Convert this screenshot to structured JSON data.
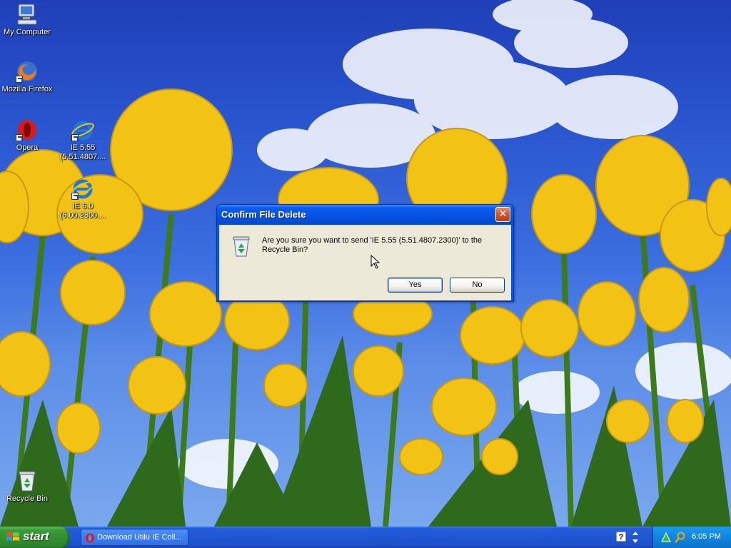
{
  "desktop": {
    "icons": [
      {
        "id": "my-computer",
        "label": "My Computer"
      },
      {
        "id": "firefox",
        "label": "Mozilla Firefox"
      },
      {
        "id": "opera",
        "label": "Opera"
      },
      {
        "id": "ie555",
        "label": "IE 5.55 (5.51.4807...."
      },
      {
        "id": "ie60",
        "label": "IE 6.0 (6.00.2800...."
      },
      {
        "id": "recycle-bin",
        "label": "Recycle Bin"
      }
    ]
  },
  "dialog": {
    "title": "Confirm File Delete",
    "close_glyph": "✕",
    "message": "Are you sure you want to send 'IE 5.55 (5.51.4807.2300)' to the Recycle Bin?",
    "yes_label": "Yes",
    "no_label": "No"
  },
  "taskbar": {
    "start_label": "start",
    "task_label": "Download Utilu IE Coll...",
    "clock": "6:05 PM"
  },
  "colors": {
    "titlebar": "#0a5cf2",
    "dialog_face": "#ece9d8",
    "start_green": "#3a9c3a",
    "taskbar_blue": "#2056d4",
    "tray_blue": "#0f86e0",
    "close_red": "#d9502c"
  }
}
